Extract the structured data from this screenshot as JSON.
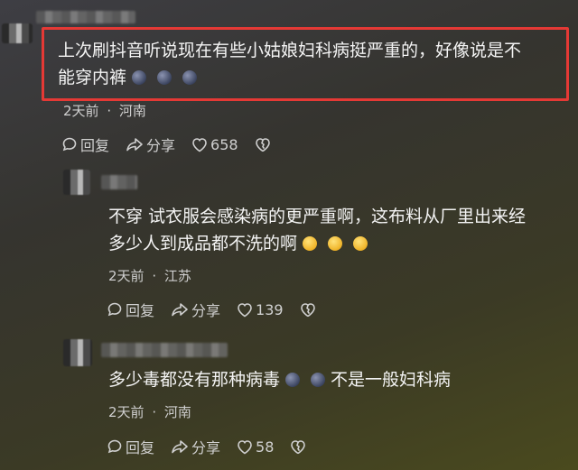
{
  "comments": [
    {
      "text_line1": "上次刷抖音听说现在有些小姑娘妇科病挺严重的，好像说是不",
      "text_line2": "能穿内裤",
      "meta_time": "2天前",
      "meta_sep": "·",
      "meta_loc": "河南",
      "reply_label": "回复",
      "share_label": "分享",
      "like_count": "658",
      "highlighted": true,
      "emoji_after_text": [
        "grimace-emoji",
        "grimace-emoji",
        "grimace-emoji"
      ]
    },
    {
      "text_line1": "不穿 试衣服会感染病的更严重啊，这布料从厂里出来经",
      "text_line2": "多少人到成品都不洗的啊",
      "meta_time": "2天前",
      "meta_sep": "·",
      "meta_loc": "江苏",
      "reply_label": "回复",
      "share_label": "分享",
      "like_count": "139",
      "emoji_after_text": [
        "grimace-yellow-emoji",
        "grimace-yellow-emoji",
        "grimace-yellow-emoji"
      ]
    },
    {
      "text_part1": "多少毒都没有那种病毒",
      "text_part2": "不是一般妇科病",
      "meta_time": "2天前",
      "meta_sep": "·",
      "meta_loc": "河南",
      "reply_label": "回复",
      "share_label": "分享",
      "like_count": "58"
    }
  ],
  "colors": {
    "highlight": "#e53935",
    "text": "#f4f4f4",
    "meta": "#cfcfcf"
  }
}
